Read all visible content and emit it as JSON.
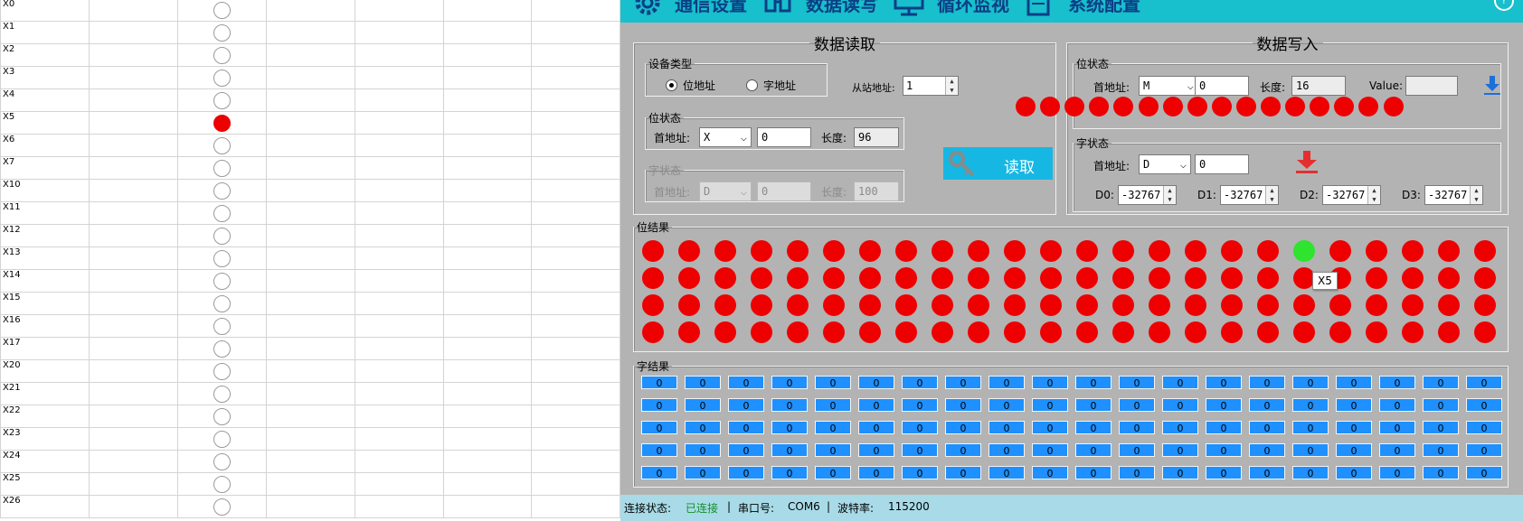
{
  "sheet": {
    "rows": [
      {
        "label": "X0",
        "on": false
      },
      {
        "label": "X1",
        "on": false
      },
      {
        "label": "X2",
        "on": false
      },
      {
        "label": "X3",
        "on": false
      },
      {
        "label": "X4",
        "on": false
      },
      {
        "label": "X5",
        "on": true
      },
      {
        "label": "X6",
        "on": false
      },
      {
        "label": "X7",
        "on": false
      },
      {
        "label": "X10",
        "on": false
      },
      {
        "label": "X11",
        "on": false
      },
      {
        "label": "X12",
        "on": false
      },
      {
        "label": "X13",
        "on": false
      },
      {
        "label": "X14",
        "on": false
      },
      {
        "label": "X15",
        "on": false
      },
      {
        "label": "X16",
        "on": false
      },
      {
        "label": "X17",
        "on": false
      },
      {
        "label": "X20",
        "on": false
      },
      {
        "label": "X21",
        "on": false
      },
      {
        "label": "X22",
        "on": false
      },
      {
        "label": "X23",
        "on": false
      },
      {
        "label": "X24",
        "on": false
      },
      {
        "label": "X25",
        "on": false
      },
      {
        "label": "X26",
        "on": false
      }
    ]
  },
  "menu": {
    "items": [
      {
        "label": "通信设置",
        "icon": "gear-icon"
      },
      {
        "label": "数据读写",
        "icon": "network-icon"
      },
      {
        "label": "循环监视",
        "icon": "monitor-icon"
      },
      {
        "label": "系统配置",
        "icon": "document-settings-icon"
      }
    ],
    "help": "?"
  },
  "read_panel": {
    "title": "数据读取",
    "device_type": {
      "legend": "设备类型",
      "bit_label": "位地址",
      "word_label": "字地址",
      "selected": "bit"
    },
    "slave": {
      "label": "从站地址:",
      "value": "1"
    },
    "bit_state": {
      "legend": "位状态",
      "addr_label": "首地址:",
      "addr_value": "X",
      "offset": "0",
      "len_label": "长度:",
      "len_value": "96"
    },
    "word_state": {
      "legend": "字状态",
      "addr_label": "首地址:",
      "addr_value": "D",
      "offset": "0",
      "len_label": "长度:",
      "len_value": "100"
    },
    "read_button": "读取"
  },
  "write_panel": {
    "title": "数据写入",
    "bit_state": {
      "legend": "位状态",
      "addr_label": "首地址:",
      "addr_value": "M",
      "offset": "0",
      "len_label": "长度:",
      "len_value": "16",
      "value_label": "Value:",
      "value": ""
    },
    "word_state": {
      "legend": "字状态",
      "addr_label": "首地址:",
      "addr_value": "D",
      "offset": "0"
    },
    "registers": [
      {
        "label": "D0:",
        "value": "-32767"
      },
      {
        "label": "D1:",
        "value": "-32767"
      },
      {
        "label": "D2:",
        "value": "-32767"
      },
      {
        "label": "D3:",
        "value": "-32767"
      }
    ]
  },
  "bit_results": {
    "legend": "位结果",
    "rows": 4,
    "cols": 24,
    "active_index": 18
  },
  "word_results": {
    "legend": "字结果",
    "rows": 5,
    "cols": 20,
    "value": "0"
  },
  "tooltip": "X5",
  "status": {
    "conn_label": "连接状态:",
    "conn_value": "已连接",
    "sep": "|",
    "port_label": "串口号:",
    "port_value": "COM6",
    "baud_label": "波特率:",
    "baud_value": "115200"
  },
  "colors": {
    "led_off": "#ee0000",
    "led_on": "#2ee42e",
    "accent": "#18bfcc",
    "word_box": "#1e90ff"
  }
}
